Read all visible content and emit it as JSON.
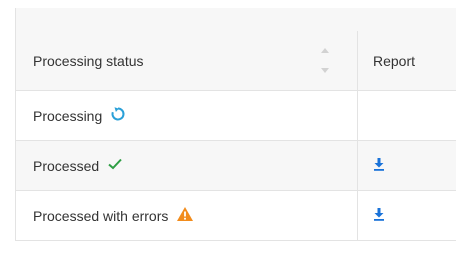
{
  "table": {
    "columns": [
      {
        "label": "Processing status",
        "sortable": true
      },
      {
        "label": "Report"
      }
    ],
    "rows": [
      {
        "status": "Processing",
        "status_icon": "refresh-icon",
        "report": null
      },
      {
        "status": "Processed",
        "status_icon": "checkmark-icon",
        "report": "download-icon"
      },
      {
        "status": "Processed with errors",
        "status_icon": "warning-icon",
        "report": "download-icon"
      }
    ]
  },
  "colors": {
    "refresh": "#2aa0d8",
    "check": "#2e9e44",
    "warning": "#f28c1c",
    "download": "#1a73d9"
  }
}
